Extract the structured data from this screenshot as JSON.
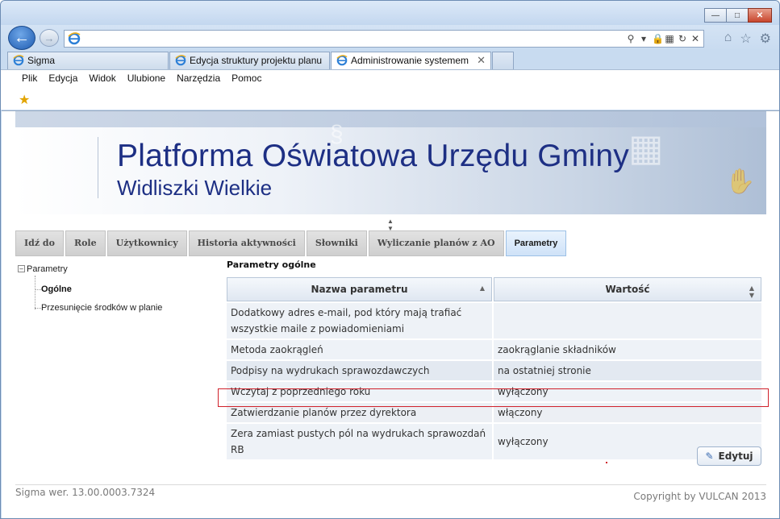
{
  "browser": {
    "address_value": "",
    "tabs": [
      {
        "label": "Sigma",
        "active": false
      },
      {
        "label": "Edycja struktury projektu planu",
        "active": false
      },
      {
        "label": "Administrowanie systemem",
        "active": true
      }
    ],
    "menu": [
      "Plik",
      "Edycja",
      "Widok",
      "Ulubione",
      "Narzędzia",
      "Pomoc"
    ],
    "window_controls": {
      "minimize": "▭",
      "maximize": "□",
      "close": "✕"
    },
    "icons": [
      "back-arrow-icon",
      "forward-arrow-icon",
      "ie-logo-icon",
      "search-icon",
      "lock-icon",
      "compat-view-icon",
      "refresh-icon",
      "stop-icon",
      "home-icon",
      "favorites-star-icon",
      "settings-gear-icon",
      "favorites-bar-icon"
    ]
  },
  "banner": {
    "title": "Platforma Oświatowa Urzędu Gminy",
    "subtitle": "Widliszki Wielkie",
    "title_color": "#1d2f84"
  },
  "nav_tabs": [
    {
      "label": "Idź do",
      "active": false
    },
    {
      "label": "Role",
      "active": false
    },
    {
      "label": "Użytkownicy",
      "active": false
    },
    {
      "label": "Historia aktywności",
      "active": false
    },
    {
      "label": "Słowniki",
      "active": false
    },
    {
      "label": "Wyliczanie planów z AO",
      "active": false
    },
    {
      "label": "Parametry",
      "active": true
    }
  ],
  "tree": {
    "root": "Parametry",
    "children": [
      {
        "label": "Ogólne",
        "selected": true
      },
      {
        "label": "Przesunięcie środków w planie",
        "selected": false
      }
    ]
  },
  "params": {
    "heading": "Parametry ogólne",
    "columns": {
      "name": "Nazwa parametru",
      "value": "Wartość"
    },
    "rows": [
      {
        "name": "Dodatkowy adres e-mail, pod który mają trafiać wszystkie maile z powiadomieniami",
        "value": ""
      },
      {
        "name": "Metoda zaokrągleń",
        "value": "zaokrąglanie składników"
      },
      {
        "name": "Podpisy na wydrukach sprawozdawczych",
        "value": "na ostatniej stronie"
      },
      {
        "name": "Wczytaj z poprzedniego roku",
        "value": "wyłączony"
      },
      {
        "name": "Zatwierdzanie planów przez dyrektora",
        "value": "włączony"
      },
      {
        "name": "Zera zamiast pustych pól na wydrukach sprawozdań RB",
        "value": "wyłączony"
      }
    ],
    "highlight_color": "#d0212b"
  },
  "actions": {
    "edit_label": "Edytuj"
  },
  "footer": {
    "version": "Sigma wer. 13.00.0003.7324",
    "copyright": "Copyright by VULCAN 2013"
  }
}
